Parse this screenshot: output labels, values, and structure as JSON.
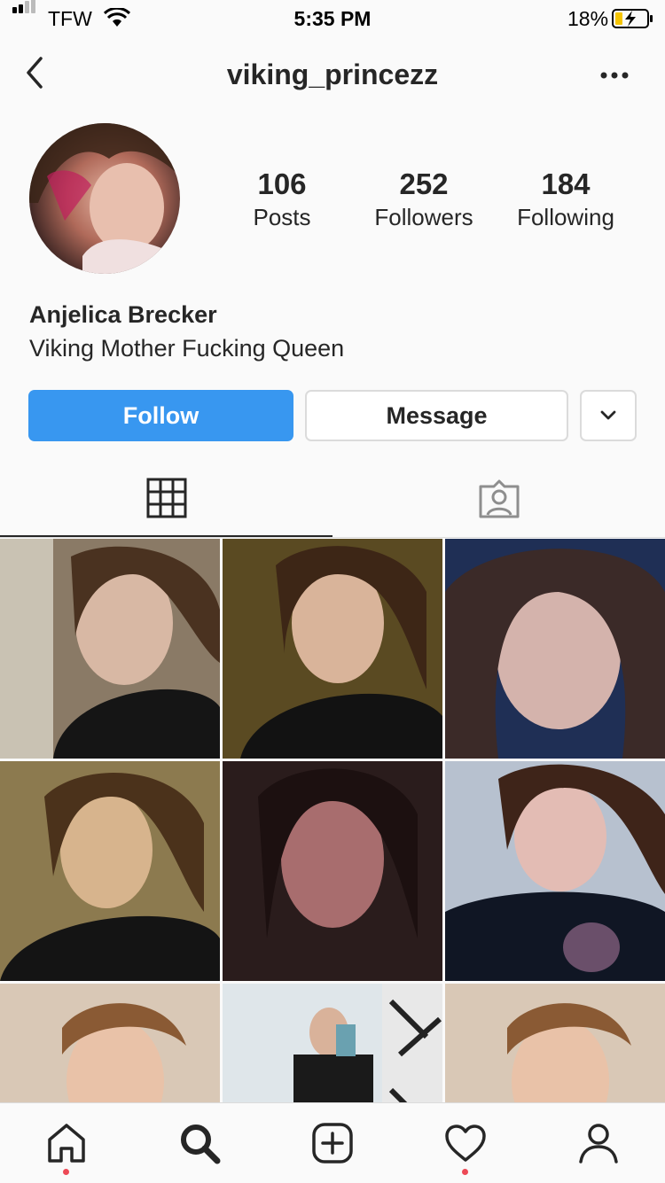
{
  "status_bar": {
    "carrier": "TFW",
    "time": "5:35 PM",
    "battery": "18%"
  },
  "header": {
    "username": "viking_princezz"
  },
  "profile": {
    "stats": [
      {
        "value": "106",
        "label": "Posts"
      },
      {
        "value": "252",
        "label": "Followers"
      },
      {
        "value": "184",
        "label": "Following"
      }
    ],
    "full_name": "Anjelica Brecker",
    "bio": "Viking Mother Fucking Queen"
  },
  "actions": {
    "follow_label": "Follow",
    "message_label": "Message"
  },
  "tabs": [
    "grid-icon",
    "tagged-icon"
  ],
  "nav": [
    "home-icon",
    "search-icon",
    "new-post-icon",
    "activity-icon",
    "profile-icon"
  ],
  "colors": {
    "accent": "#3897f0",
    "notification": "#ed4956"
  }
}
